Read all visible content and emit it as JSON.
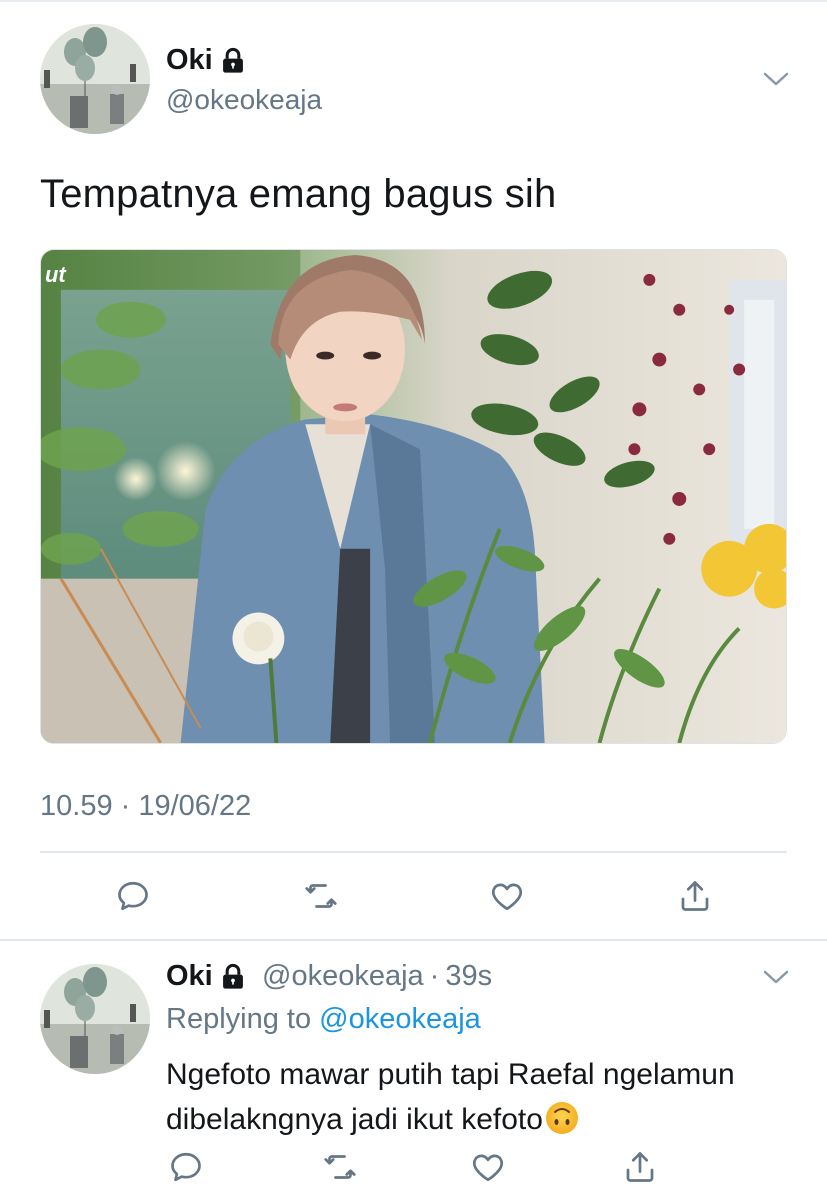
{
  "main_tweet": {
    "display_name": "Oki",
    "handle": "@okeokeaja",
    "text": "Tempatnya emang bagus sih",
    "media_watermark": "ut",
    "timestamp": "10.59 · 19/06/22",
    "icons": {
      "lock": "lock-icon",
      "chevron": "chevron-down-icon",
      "reply": "reply-icon",
      "retweet": "retweet-icon",
      "like": "heart-icon",
      "share": "share-icon"
    }
  },
  "reply_tweet": {
    "display_name": "Oki",
    "handle": "@okeokeaja",
    "separator": "·",
    "time": "39s",
    "replying_prefix": "Replying to",
    "replying_to": "@okeokeaja",
    "text": "Ngefoto mawar putih tapi Raefal ngelamun dibelakngnya jadi ikut kefoto",
    "emoji": "upside-down-face"
  },
  "colors": {
    "text": "#14171a",
    "secondary": "#657786",
    "link": "#1b95e0",
    "divider": "#e1e8ed"
  }
}
